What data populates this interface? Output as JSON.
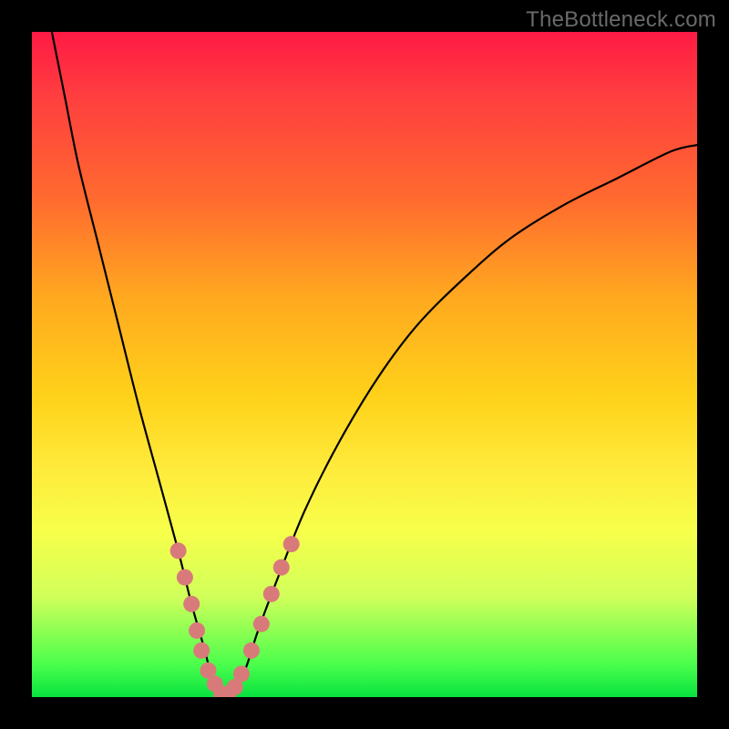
{
  "watermark": "TheBottleneck.com",
  "chart_data": {
    "type": "line",
    "title": "",
    "xlabel": "",
    "ylabel": "",
    "xlim": [
      0,
      100
    ],
    "ylim": [
      0,
      100
    ],
    "grid": false,
    "series": [
      {
        "name": "bottleneck-curve",
        "x": [
          3,
          5,
          7,
          10,
          13,
          16,
          19,
          22,
          24,
          26,
          27,
          28,
          29,
          30,
          32,
          34,
          37,
          41,
          46,
          52,
          58,
          65,
          72,
          80,
          88,
          96,
          100
        ],
        "y": [
          100,
          90,
          80,
          68,
          56,
          44,
          33,
          22,
          14,
          7,
          3,
          1,
          0,
          1,
          4,
          10,
          18,
          28,
          38,
          48,
          56,
          63,
          69,
          74,
          78,
          82,
          83
        ]
      }
    ],
    "markers": [
      {
        "name": "highlight-markers",
        "color": "#d97a7a",
        "shape": "circle",
        "radius_px": 9,
        "points": [
          {
            "x": 22.0,
            "y": 22.0
          },
          {
            "x": 23.0,
            "y": 18.0
          },
          {
            "x": 24.0,
            "y": 14.0
          },
          {
            "x": 24.8,
            "y": 10.0
          },
          {
            "x": 25.5,
            "y": 7.0
          },
          {
            "x": 26.5,
            "y": 4.0
          },
          {
            "x": 27.5,
            "y": 2.0
          },
          {
            "x": 28.5,
            "y": 0.5
          },
          {
            "x": 29.5,
            "y": 0.5
          },
          {
            "x": 30.5,
            "y": 1.5
          },
          {
            "x": 31.5,
            "y": 3.5
          },
          {
            "x": 33.0,
            "y": 7.0
          },
          {
            "x": 34.5,
            "y": 11.0
          },
          {
            "x": 36.0,
            "y": 15.5
          },
          {
            "x": 37.5,
            "y": 19.5
          },
          {
            "x": 39.0,
            "y": 23.0
          }
        ]
      }
    ]
  }
}
